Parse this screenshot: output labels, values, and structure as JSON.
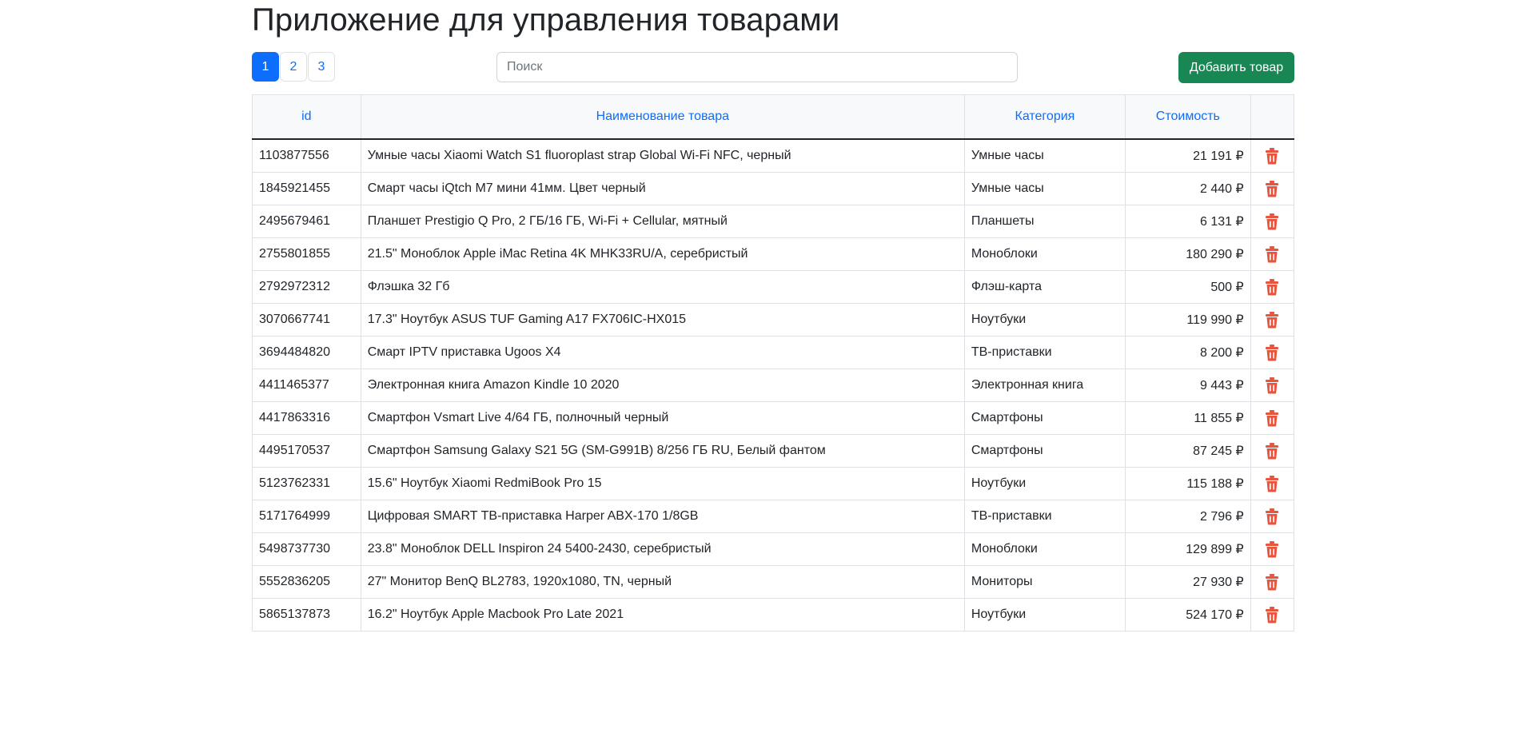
{
  "header": {
    "title": "Приложение для управления товарами"
  },
  "pagination": {
    "pages": [
      "1",
      "2",
      "3"
    ],
    "active": "1"
  },
  "search": {
    "placeholder": "Поиск",
    "value": ""
  },
  "toolbar": {
    "add_label": "Добавить товар"
  },
  "colors": {
    "primary": "#0d6efd",
    "success": "#198754",
    "danger": "#e8553e"
  },
  "icons": {
    "delete": "trash-icon"
  },
  "table": {
    "columns": [
      "id",
      "Наименование товара",
      "Категория",
      "Стоимость",
      ""
    ],
    "rows": [
      {
        "id": "1103877556",
        "name": "Умные часы Xiaomi Watch S1 fluoroplast strap Global Wi-Fi NFC, черный",
        "category": "Умные часы",
        "price": "21 191 ₽"
      },
      {
        "id": "1845921455",
        "name": "Смарт часы iQtch M7 мини 41мм. Цвет черный",
        "category": "Умные часы",
        "price": "2 440 ₽"
      },
      {
        "id": "2495679461",
        "name": "Планшет Prestigio Q Pro, 2 ГБ/16 ГБ, Wi-Fi + Cellular, мятный",
        "category": "Планшеты",
        "price": "6 131 ₽"
      },
      {
        "id": "2755801855",
        "name": "21.5\" Моноблок Apple iMac Retina 4K MHK33RU/A, серебристый",
        "category": "Моноблоки",
        "price": "180 290 ₽"
      },
      {
        "id": "2792972312",
        "name": "Флэшка 32 Гб",
        "category": "Флэш-карта",
        "price": "500 ₽"
      },
      {
        "id": "3070667741",
        "name": "17.3\" Ноутбук ASUS TUF Gaming A17 FX706IC-HX015",
        "category": "Ноутбуки",
        "price": "119 990 ₽"
      },
      {
        "id": "3694484820",
        "name": "Смарт IPTV приставка Ugoos X4",
        "category": "ТВ-приставки",
        "price": "8 200 ₽"
      },
      {
        "id": "4411465377",
        "name": "Электронная книга Amazon Kindle 10 2020",
        "category": "Электронная книга",
        "price": "9 443 ₽"
      },
      {
        "id": "4417863316",
        "name": "Смартфон Vsmart Live 4/64 ГБ, полночный черный",
        "category": "Смартфоны",
        "price": "11 855 ₽"
      },
      {
        "id": "4495170537",
        "name": "Смартфон Samsung Galaxy S21 5G (SM-G991B) 8/256 ГБ RU, Белый фантом",
        "category": "Смартфоны",
        "price": "87 245 ₽"
      },
      {
        "id": "5123762331",
        "name": "15.6\" Ноутбук Xiaomi RedmiBook Pro 15",
        "category": "Ноутбуки",
        "price": "115 188 ₽"
      },
      {
        "id": "5171764999",
        "name": "Цифровая SMART ТВ-приставка Harper ABX-170 1/8GB",
        "category": "ТВ-приставки",
        "price": "2 796 ₽"
      },
      {
        "id": "5498737730",
        "name": "23.8\" Моноблок DELL Inspiron 24 5400-2430, серебристый",
        "category": "Моноблоки",
        "price": "129 899 ₽"
      },
      {
        "id": "5552836205",
        "name": "27\" Монитор BenQ BL2783, 1920x1080, TN, черный",
        "category": "Мониторы",
        "price": "27 930 ₽"
      },
      {
        "id": "5865137873",
        "name": "16.2\" Ноутбук Apple Macbook Pro Late 2021",
        "category": "Ноутбуки",
        "price": "524 170 ₽"
      }
    ]
  }
}
